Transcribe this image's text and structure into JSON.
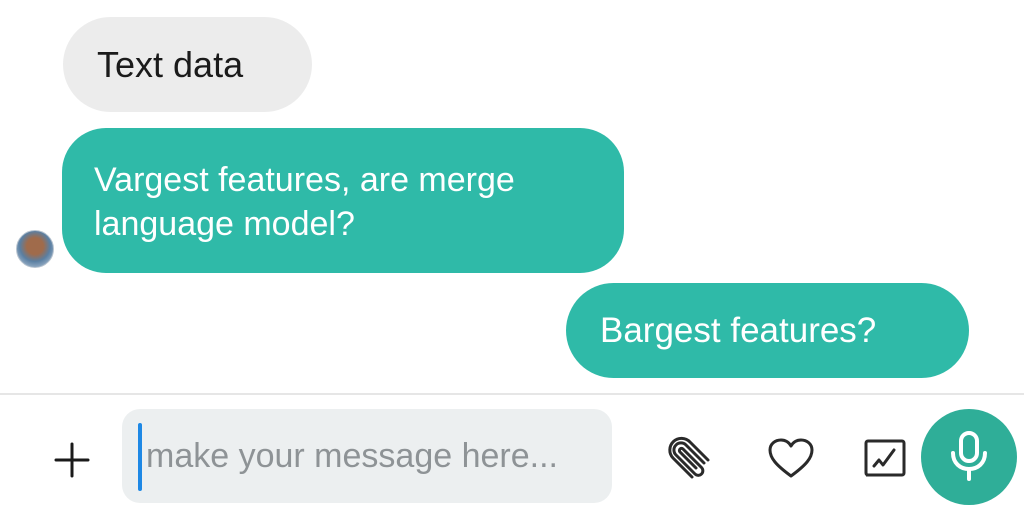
{
  "messages": [
    {
      "direction": "incoming",
      "style": "gray",
      "text": "Text data"
    },
    {
      "direction": "incoming",
      "style": "teal",
      "lines": [
        "Vargest features, are merge",
        "language model?"
      ]
    },
    {
      "direction": "outgoing",
      "style": "teal",
      "text": "Bargest features?"
    }
  ],
  "composer": {
    "placeholder": "make your message here...",
    "value": ""
  },
  "icons": {
    "add": "plus-icon",
    "attach": "paperclip-icon",
    "like": "heart-icon",
    "edit": "edit-icon",
    "voice": "microphone-icon"
  },
  "colors": {
    "teal_bubble": "#2fbaa8",
    "gray_bubble": "#ececec",
    "mic_button": "#2fae98",
    "caret": "#1e88e5"
  }
}
